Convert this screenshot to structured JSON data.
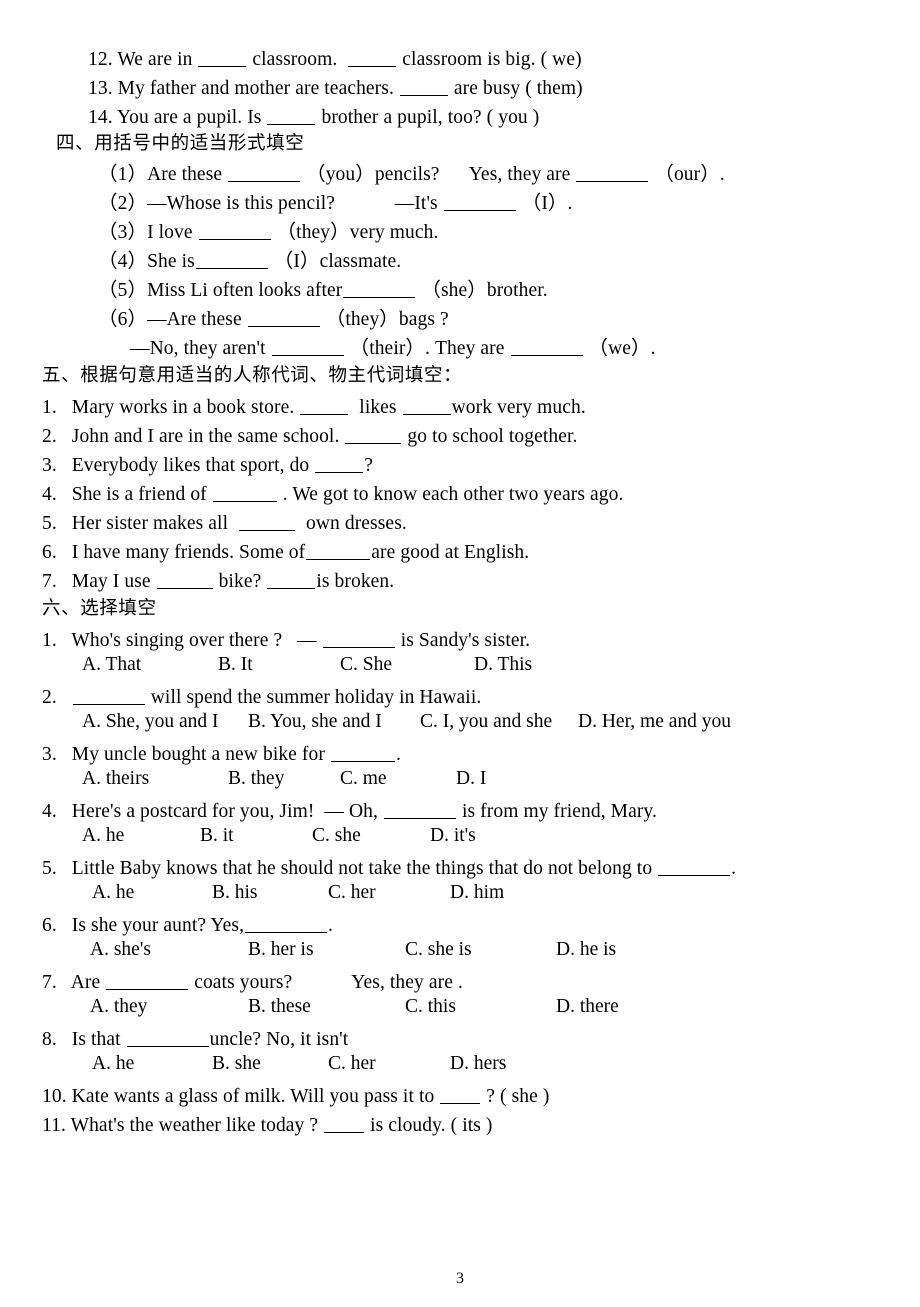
{
  "document": {
    "page_number": "3"
  },
  "top_items": [
    {
      "n": "12.",
      "pre": "We are in",
      "mid": "classroom.",
      "post": "classroom is big. ( we)"
    },
    {
      "n": "13.",
      "pre": "My father and mother are teachers.",
      "post": "are busy ( them)"
    },
    {
      "n": "14.",
      "pre": "You are a pupil. Is",
      "post": "brother a pupil, too? ( you )"
    }
  ],
  "section_four": {
    "heading": "四、用括号中的适当形式填空",
    "items": [
      {
        "n": "（1）",
        "a": "Are these",
        "b": "（you）pencils?",
        "c": "Yes, they are",
        "d": "（our）."
      },
      {
        "n": "（2）",
        "a": "—Whose is this pencil?",
        "b": "—It's",
        "c": "（I）."
      },
      {
        "n": "（3）",
        "a": "I love",
        "b": "（they）very much."
      },
      {
        "n": "（4）",
        "a": "She is",
        "b": "（I）classmate."
      },
      {
        "n": "（5）",
        "a": "Miss Li often looks after",
        "b": "（she）brother."
      },
      {
        "n": "（6）",
        "a": "—Are these",
        "b": "（they）bags ?"
      },
      {
        "n": "",
        "a": "—No, they aren't",
        "b": "（their）. They are",
        "c": "（we）."
      }
    ]
  },
  "section_five": {
    "heading": "五、根据句意用适当的人称代词、物主代词填空：",
    "items": [
      {
        "n": "1.",
        "a": "Mary works in a book store.",
        "b": "likes",
        "c": "work very much."
      },
      {
        "n": "2.",
        "a": "John and I are in the same school.",
        "b": "go to school together."
      },
      {
        "n": "3.",
        "a": "Everybody likes that sport, do",
        "b": "?"
      },
      {
        "n": "4.",
        "a": "She is a friend of",
        "b": ". We got to know each other two years ago."
      },
      {
        "n": "5.",
        "a": "Her sister makes all",
        "b": "own dresses."
      },
      {
        "n": "6.",
        "a": "I have many friends. Some of",
        "b": "are good at English."
      },
      {
        "n": "7.",
        "a": "May I use",
        "b": "bike?",
        "c": "is broken."
      }
    ]
  },
  "section_six": {
    "heading": "六、选择填空",
    "questions": [
      {
        "n": "1.",
        "stem_pre": "Who's singing over there ?   —",
        "stem_post": "is Sandy's sister.",
        "options": [
          "A. That",
          "B. It",
          "C. She",
          "D. This"
        ]
      },
      {
        "n": "2.",
        "stem_pre": "",
        "stem_post": "will spend the summer holiday in Hawaii.",
        "options": [
          "A. She, you and I",
          "B. You, she and I",
          "C. I, you and she",
          "D. Her, me and you"
        ]
      },
      {
        "n": "3.",
        "stem_pre": "My uncle bought a new bike for",
        "stem_post": ".",
        "options": [
          "A. theirs",
          "B. they",
          "C. me",
          "D. I"
        ]
      },
      {
        "n": "4.",
        "stem_pre": "Here's a postcard for you, Jim!  — Oh,",
        "stem_post": "is from my friend, Mary.",
        "options": [
          "A. he",
          "B. it",
          "C. she",
          "D. it's"
        ]
      },
      {
        "n": "5.",
        "stem_pre": "Little Baby knows that he should not take the things that do not belong to",
        "stem_post": ".",
        "options": [
          "A. he",
          "B. his",
          "C. her",
          "D. him"
        ]
      },
      {
        "n": "6.",
        "stem_pre": "Is she your aunt? Yes,",
        "stem_post": ".",
        "options": [
          "A. she's",
          "B. her is",
          "C. she is",
          "D. he is"
        ]
      },
      {
        "n": "7.",
        "stem_pre": "Are",
        "stem_post": "coats yours?            Yes, they are .",
        "options": [
          "A. they",
          "B. these",
          "C. this",
          "D. there"
        ]
      },
      {
        "n": "8.",
        "stem_pre": "Is that",
        "stem_post": "uncle? No, it isn't",
        "options": [
          "A. he",
          "B. she",
          "C. her",
          "D. hers"
        ]
      }
    ],
    "tail_items": [
      {
        "n": "10.",
        "pre": "Kate wants a glass of milk. Will you pass it to",
        "post": "? ( she )"
      },
      {
        "n": "11.",
        "pre": "What's the weather like today ?",
        "post": "is cloudy. ( its )"
      }
    ]
  }
}
